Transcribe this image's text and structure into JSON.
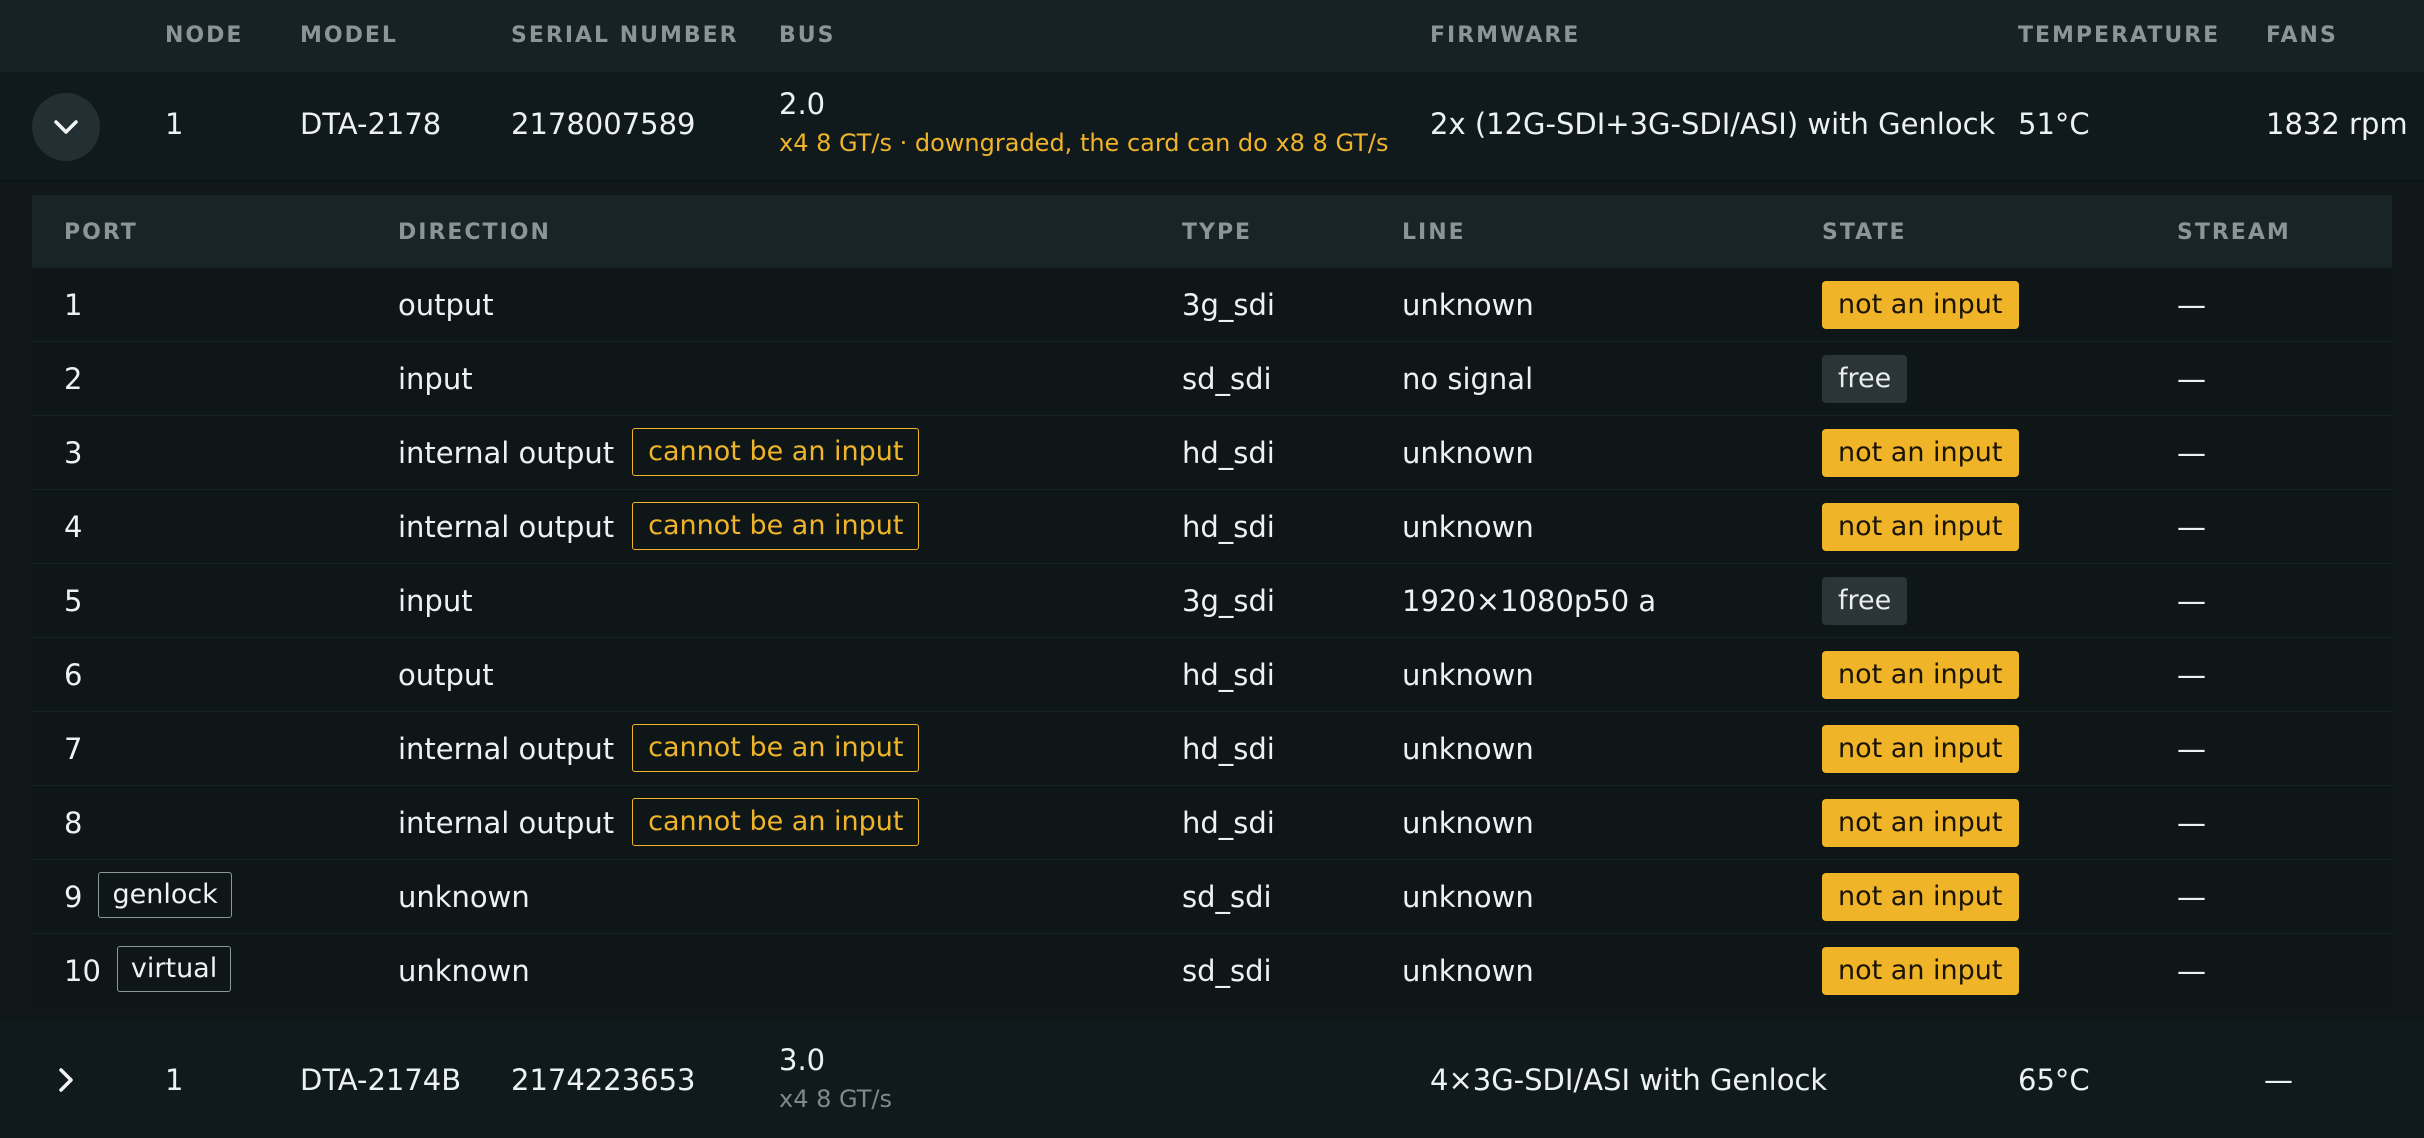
{
  "header": {
    "node": "NODE",
    "model": "MODEL",
    "serial": "SERIAL NUMBER",
    "bus": "BUS",
    "firmware": "FIRMWARE",
    "temperature": "TEMPERATURE",
    "fans": "FANS"
  },
  "devices": [
    {
      "expanded": true,
      "node": "1",
      "model": "DTA-2178",
      "serial": "2178007589",
      "bus_version": "2.0",
      "bus_detail": "x4 8 GT/s · downgraded, the card can do x8 8 GT/s",
      "firmware": "2x (12G-SDI+3G-SDI/ASI) with Genlock",
      "temperature": "51°C",
      "fans": "1832 rpm"
    },
    {
      "expanded": false,
      "node": "1",
      "model": "DTA-2174B",
      "serial": "2174223653",
      "bus_version": "3.0",
      "bus_detail": "x4 8 GT/s",
      "firmware": "4×3G-SDI/ASI with Genlock",
      "temperature": "65°C",
      "fans": "—"
    }
  ],
  "ports_header": {
    "port": "PORT",
    "direction": "DIRECTION",
    "type": "TYPE",
    "line": "LINE",
    "state": "STATE",
    "stream": "STREAM"
  },
  "ports": [
    {
      "port": "1",
      "tag": "",
      "direction": "output",
      "cannot": "",
      "type": "3g_sdi",
      "line": "unknown",
      "state": "not an input",
      "stream": "—"
    },
    {
      "port": "2",
      "tag": "",
      "direction": "input",
      "cannot": "",
      "type": "sd_sdi",
      "line": "no signal",
      "state": "free",
      "stream": "—"
    },
    {
      "port": "3",
      "tag": "",
      "direction": "internal output",
      "cannot": "cannot be an input",
      "type": "hd_sdi",
      "line": "unknown",
      "state": "not an input",
      "stream": "—"
    },
    {
      "port": "4",
      "tag": "",
      "direction": "internal output",
      "cannot": "cannot be an input",
      "type": "hd_sdi",
      "line": "unknown",
      "state": "not an input",
      "stream": "—"
    },
    {
      "port": "5",
      "tag": "",
      "direction": "input",
      "cannot": "",
      "type": "3g_sdi",
      "line": "1920×1080p50 a",
      "state": "free",
      "stream": "—"
    },
    {
      "port": "6",
      "tag": "",
      "direction": "output",
      "cannot": "",
      "type": "hd_sdi",
      "line": "unknown",
      "state": "not an input",
      "stream": "—"
    },
    {
      "port": "7",
      "tag": "",
      "direction": "internal output",
      "cannot": "cannot be an input",
      "type": "hd_sdi",
      "line": "unknown",
      "state": "not an input",
      "stream": "—"
    },
    {
      "port": "8",
      "tag": "",
      "direction": "internal output",
      "cannot": "cannot be an input",
      "type": "hd_sdi",
      "line": "unknown",
      "state": "not an input",
      "stream": "—"
    },
    {
      "port": "9",
      "tag": "genlock",
      "direction": "unknown",
      "cannot": "",
      "type": "sd_sdi",
      "line": "unknown",
      "state": "not an input",
      "stream": "—"
    },
    {
      "port": "10",
      "tag": "virtual",
      "direction": "unknown",
      "cannot": "",
      "type": "sd_sdi",
      "line": "unknown",
      "state": "not an input",
      "stream": "—"
    }
  ],
  "colors": {
    "accent_warning": "#f0b429",
    "state_free_bg": "#2b3537",
    "background": "#0f1719"
  },
  "icons": {
    "expanded_toggle": "chevron-down-icon",
    "collapsed_toggle": "chevron-right-icon"
  }
}
